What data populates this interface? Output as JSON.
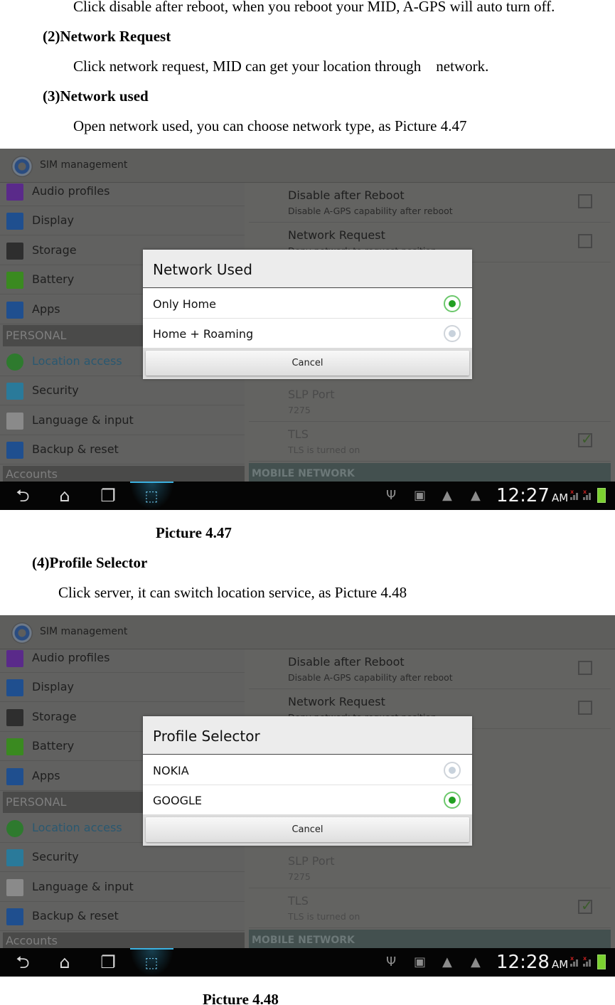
{
  "document": {
    "line1": "Click disable after reboot, when you reboot your MID, A-GPS will auto turn off.",
    "heading2": "(2)Network Request",
    "line2": "Click network request, MID can get your location through    network.",
    "heading3": "(3)Network used",
    "line3": "Open network used, you can choose network type, as Picture 4.47",
    "caption1": "Picture 4.47",
    "heading4": "(4)Profile Selector",
    "line4": "Click server, it can switch location service, as Picture 4.48",
    "caption2": "Picture 4.48"
  },
  "screens": [
    {
      "action_bar": {
        "icon": "settings-gear-icon",
        "title": "SIM management"
      },
      "sidebar": {
        "items": [
          {
            "label": "Audio profiles",
            "icon": "audio-profiles-icon",
            "color": "#5a2a8a"
          },
          {
            "label": "Display",
            "icon": "display-icon",
            "color": "#1f4f8f"
          },
          {
            "label": "Storage",
            "icon": "storage-icon",
            "color": "#2e2e2e"
          },
          {
            "label": "Battery",
            "icon": "battery-icon",
            "color": "#3a8a20"
          },
          {
            "label": "Apps",
            "icon": "apps-icon",
            "color": "#1f4f8f"
          }
        ],
        "section_personal": "PERSONAL",
        "personal_items": [
          {
            "label": "Location access",
            "icon": "location-icon",
            "color": "#2e7a2e",
            "active": true
          },
          {
            "label": "Security",
            "icon": "lock-icon",
            "color": "#2a7a9a"
          },
          {
            "label": "Language & input",
            "icon": "language-icon",
            "color": "#8a8a8a"
          },
          {
            "label": "Backup & reset",
            "icon": "backup-icon",
            "color": "#1f4f8f"
          }
        ],
        "section_accounts": "Accounts"
      },
      "content": {
        "prefs": [
          {
            "title": "Disable after Reboot",
            "summary": "Disable A-GPS capability after reboot",
            "checked": false
          },
          {
            "title": "Network Request",
            "summary": "Deny network to request position",
            "checked": false
          },
          {
            "title": "SLP Port",
            "summary": "7275"
          },
          {
            "title": "TLS",
            "summary": "TLS is turned on",
            "checked": true
          }
        ],
        "section_mobile": "MOBILE NETWORK"
      },
      "dialog": {
        "title": "Network Used",
        "options": [
          {
            "label": "Only Home",
            "selected": true
          },
          {
            "label": "Home + Roaming",
            "selected": false
          }
        ],
        "cancel": "Cancel"
      },
      "status_bar": {
        "time": "12:27",
        "ampm": "AM"
      }
    },
    {
      "action_bar": {
        "icon": "settings-gear-icon",
        "title": "SIM management"
      },
      "sidebar": {
        "items": [
          {
            "label": "Audio profiles",
            "icon": "audio-profiles-icon",
            "color": "#5a2a8a"
          },
          {
            "label": "Display",
            "icon": "display-icon",
            "color": "#1f4f8f"
          },
          {
            "label": "Storage",
            "icon": "storage-icon",
            "color": "#2e2e2e"
          },
          {
            "label": "Battery",
            "icon": "battery-icon",
            "color": "#3a8a20"
          },
          {
            "label": "Apps",
            "icon": "apps-icon",
            "color": "#1f4f8f"
          }
        ],
        "section_personal": "PERSONAL",
        "personal_items": [
          {
            "label": "Location access",
            "icon": "location-icon",
            "color": "#2e7a2e",
            "active": true
          },
          {
            "label": "Security",
            "icon": "lock-icon",
            "color": "#2a7a9a"
          },
          {
            "label": "Language & input",
            "icon": "language-icon",
            "color": "#8a8a8a"
          },
          {
            "label": "Backup & reset",
            "icon": "backup-icon",
            "color": "#1f4f8f"
          }
        ],
        "section_accounts": "Accounts"
      },
      "content": {
        "prefs": [
          {
            "title": "Disable after Reboot",
            "summary": "Disable A-GPS capability after reboot",
            "checked": false
          },
          {
            "title": "Network Request",
            "summary": "Deny network to request position",
            "checked": false
          },
          {
            "title": "SLP Port",
            "summary": "7275"
          },
          {
            "title": "TLS",
            "summary": "TLS is turned on",
            "checked": true
          }
        ],
        "section_mobile": "MOBILE NETWORK"
      },
      "dialog": {
        "title": "Profile Selector",
        "options": [
          {
            "label": "NOKIA",
            "selected": false
          },
          {
            "label": "GOOGLE",
            "selected": true
          }
        ],
        "cancel": "Cancel"
      },
      "status_bar": {
        "time": "12:28",
        "ampm": "AM"
      }
    }
  ],
  "nav_icons": [
    "back-icon",
    "home-icon",
    "recent-apps-icon",
    "screenshot-icon"
  ],
  "status_icons": [
    "usb-icon",
    "image-icon",
    "warning-icon",
    "warning-icon"
  ]
}
